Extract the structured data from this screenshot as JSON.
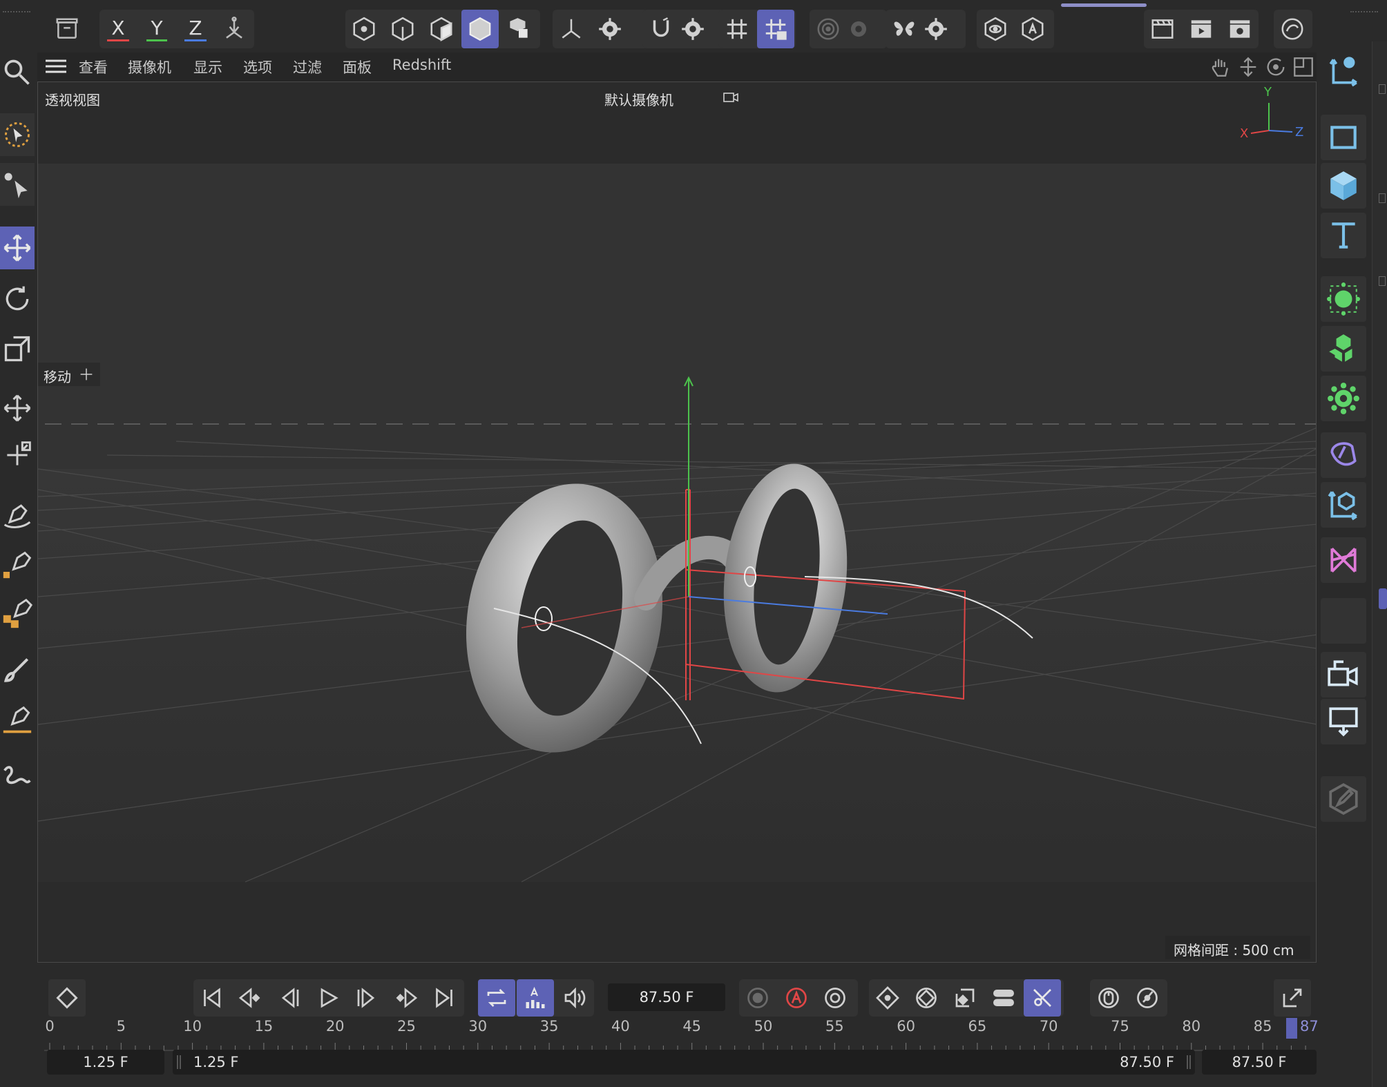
{
  "toolbar": {
    "axis_x": "X",
    "axis_y": "Y",
    "axis_z": "Z"
  },
  "menu": {
    "items": [
      "查看",
      "摄像机",
      "显示",
      "选项",
      "过滤",
      "面板",
      "Redshift"
    ]
  },
  "viewport": {
    "view_name": "透视视图",
    "camera_name": "默认摄像机",
    "tool_label": "移动",
    "grid_spacing": "网格间距 : 500 cm",
    "gizmo_x": "X",
    "gizmo_y": "Y",
    "gizmo_z": "Z"
  },
  "timeline": {
    "current_frame": "87.50 F",
    "ruler_labels": [
      "0",
      "5",
      "10",
      "15",
      "20",
      "25",
      "30",
      "35",
      "40",
      "45",
      "50",
      "55",
      "60",
      "65",
      "70",
      "75",
      "80",
      "85"
    ],
    "playhead_label": "87",
    "range_start": "1.25 F",
    "preview_start": "1.25 F",
    "preview_end": "87.50 F",
    "range_end": "87.50 F"
  },
  "colors": {
    "accent": "#5d62b5",
    "axis_x": "#e04646",
    "axis_y": "#4cc24c",
    "axis_z": "#4a7be0",
    "icon_blue": "#7bc0e8",
    "icon_green": "#5fd46a",
    "icon_purple": "#9b87e8",
    "icon_pink": "#e07ad8"
  }
}
